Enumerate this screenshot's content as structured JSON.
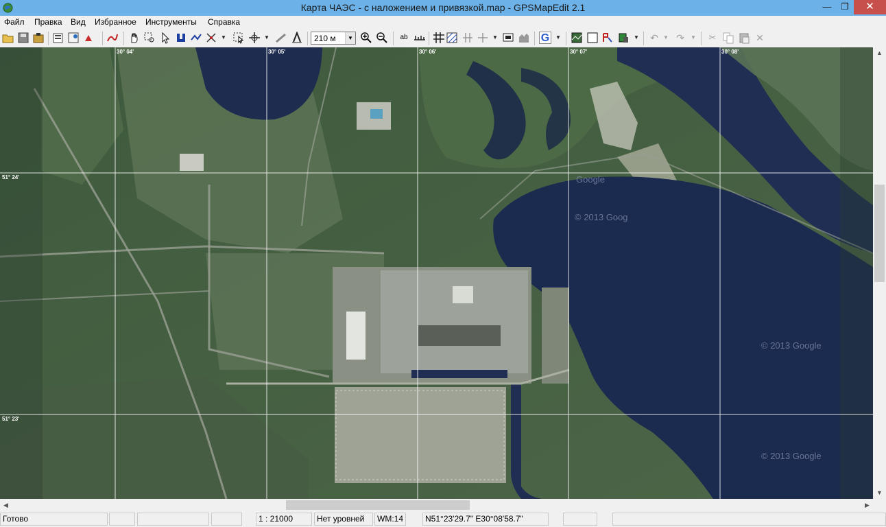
{
  "window": {
    "title": "Карта ЧАЭС - с наложением и привязкой.map - GPSMapEdit 2.1",
    "minimize_glyph": "—",
    "maximize_glyph": "❐",
    "close_glyph": "✕"
  },
  "menu": {
    "file": "Файл",
    "edit": "Правка",
    "view": "Вид",
    "favorites": "Избранное",
    "tools": "Инструменты",
    "help": "Справка"
  },
  "toolbar": {
    "zoom_level": "210 м",
    "google_label": "G",
    "label_tool": "ab"
  },
  "map": {
    "grid_labels": {
      "lon_1": "30° 04'",
      "lon_2": "30° 05'",
      "lon_3": "30° 06'",
      "lon_4": "30° 07'",
      "lon_5": "30° 08'",
      "lat_1": "51° 24'",
      "lat_2": "51° 23'"
    },
    "watermarks": {
      "w1": "© 2013 Goog",
      "w2": "© 2013 Google",
      "w3": "© 2013 Google",
      "w4": "Google"
    }
  },
  "statusbar": {
    "ready": "Готово",
    "scale": "1 : 21000",
    "levels": "Нет уровней",
    "wm": "WM:14",
    "coords": "N51°23'29.7\" E30°08'58.7\""
  },
  "colors": {
    "titlebar": "#6cb2e8",
    "close_button": "#c7504a",
    "water": "#1c2a4e",
    "forest": "#3f5a3a"
  }
}
